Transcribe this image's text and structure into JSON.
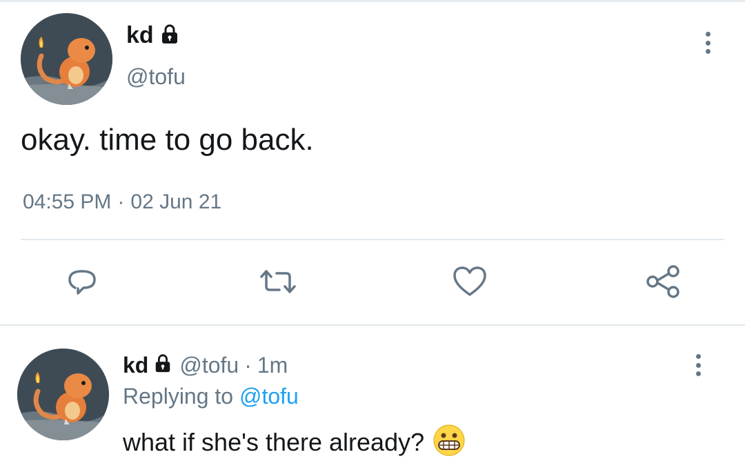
{
  "tweet": {
    "display_name": "kd",
    "handle": "@tofu",
    "text": "okay. time to go back.",
    "time": "04:55 PM",
    "separator": "·",
    "date": "02 Jun 21"
  },
  "actions": {
    "icons": [
      "reply-icon",
      "retweet-icon",
      "like-icon",
      "share-icon"
    ]
  },
  "reply": {
    "display_name": "kd",
    "handle": "@tofu",
    "separator": "·",
    "age": "1m",
    "replying_prefix": "Replying to",
    "replying_to": "@tofu",
    "text": "what if she's there already?",
    "emoji": "grimacing-face-emoji"
  },
  "colors": {
    "text": "#14171a",
    "secondary": "#657786",
    "link": "#1da1f2",
    "divider": "#e1e8ed"
  }
}
